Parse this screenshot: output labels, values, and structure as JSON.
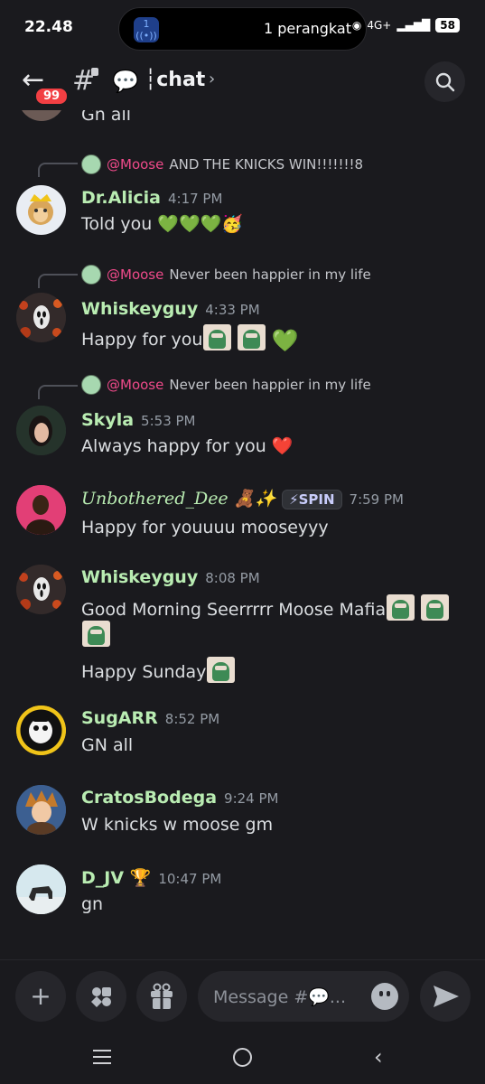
{
  "status_bar": {
    "time": "22.48",
    "island_icon_label": "1",
    "island_text": "1 perangkat",
    "network": "4G+",
    "battery": "58"
  },
  "header": {
    "unread_badge": "99",
    "channel_emoji": "💬",
    "channel_name": "chat"
  },
  "previous_message_partial": "Gn all",
  "messages": [
    {
      "reply_to": {
        "mention": "@Moose",
        "text": "AND THE KNICKS WIN!!!!!!!8"
      },
      "author": "Dr.Alicia",
      "time": "4:17 PM",
      "lines": [
        "Told you 💚💚💚🥳"
      ],
      "author_color": "#b9ecb2"
    },
    {
      "reply_to": {
        "mention": "@Moose",
        "text": "Never been happier in my life"
      },
      "author": "Whiskeyguy",
      "time": "4:33 PM",
      "lines": [
        "Happy for you"
      ],
      "trailing": "💚",
      "author_color": "#b9ecb2"
    },
    {
      "reply_to": {
        "mention": "@Moose",
        "text": "Never been happier in my life"
      },
      "author": "Skyla",
      "time": "5:53 PM",
      "lines": [
        "Always happy for you ❤️"
      ],
      "author_color": "#b9ecb2"
    },
    {
      "author": "Unbothered_Dee",
      "author_suffix": "🧸✨",
      "tag": "⚡SPIN",
      "time": "7:59 PM",
      "lines": [
        "Happy for youuuu mooseyyy"
      ],
      "author_color": "#b9ecb2"
    },
    {
      "author": "Whiskeyguy",
      "time": "8:08 PM",
      "lines": [
        "Good Morning Seerrrrr Moose Mafia",
        "Happy Sunday"
      ],
      "author_color": "#b9ecb2"
    },
    {
      "author": "SugARR",
      "time": "8:52 PM",
      "lines": [
        "GN all"
      ],
      "author_color": "#b9ecb2"
    },
    {
      "author": "CratosBodega",
      "time": "9:24 PM",
      "lines": [
        "W knicks w moose gm"
      ],
      "author_color": "#b9ecb2"
    },
    {
      "author": "D_JV",
      "author_suffix": "🏆",
      "time": "10:47 PM",
      "lines": [
        "gn"
      ],
      "author_color": "#b9ecb2"
    }
  ],
  "composer": {
    "placeholder": "Message #💬..."
  },
  "icons": [
    "back-arrow-icon",
    "hash-lock-icon",
    "search-icon",
    "plus-icon",
    "apps-icon",
    "gift-icon",
    "emoji-icon",
    "send-icon"
  ]
}
